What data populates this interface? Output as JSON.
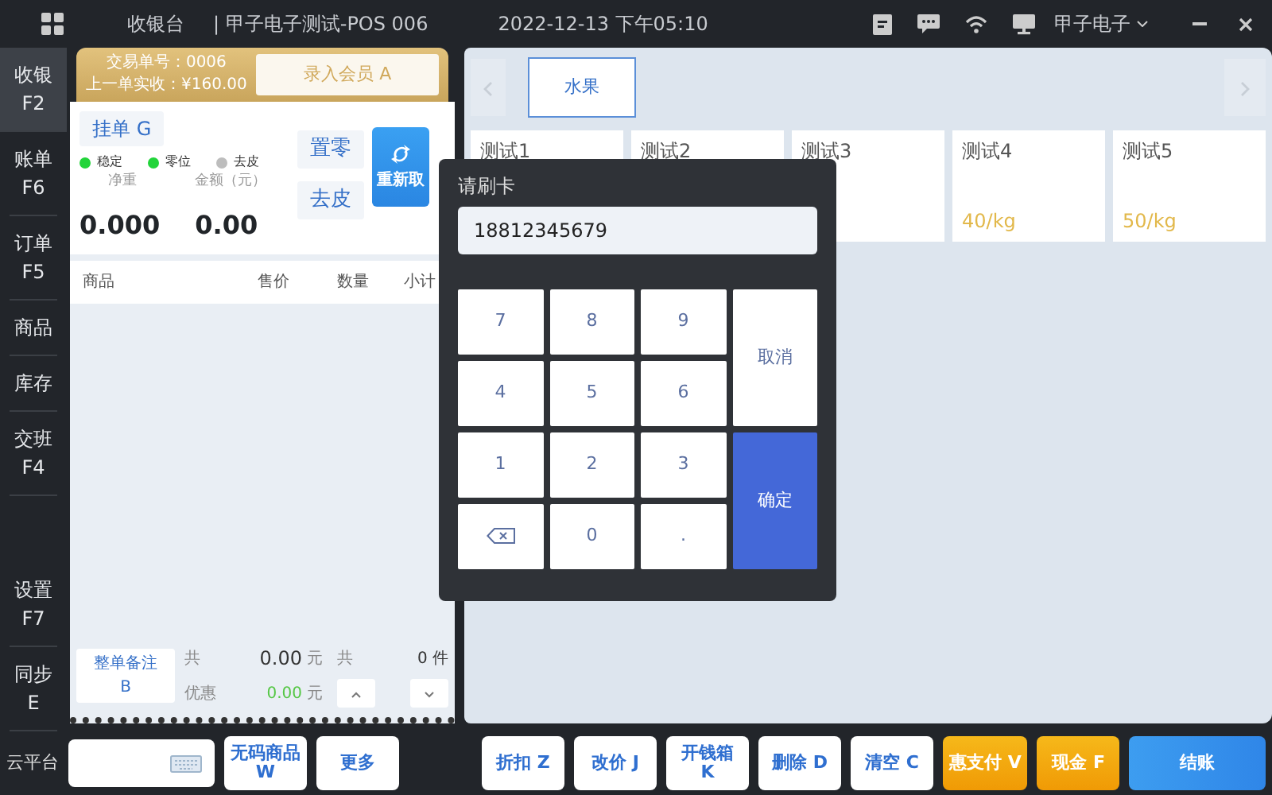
{
  "top_bar": {
    "app_title": "收银台",
    "store": "| 甲子电子测试-POS 006",
    "datetime": "2022-12-13 下午05:10",
    "user": "甲子电子"
  },
  "sidebar": {
    "items": [
      {
        "label": "收银",
        "hotkey": "F2",
        "selected": true
      },
      {
        "label": "账单",
        "hotkey": "F6",
        "selected": false
      },
      {
        "label": "订单",
        "hotkey": "F5",
        "selected": false
      },
      {
        "label": "商品",
        "selected": false
      },
      {
        "label": "库存",
        "selected": false
      },
      {
        "label": "交班",
        "hotkey": "F4",
        "selected": false
      }
    ],
    "bottom_items": [
      {
        "label": "设置",
        "hotkey": "F7",
        "selected": false
      },
      {
        "label": "同步",
        "hotkey": "E",
        "selected": false
      }
    ]
  },
  "order_header": {
    "trade_no": "交易单号：0006",
    "last_paid": "上一单实收：¥160.00",
    "member_button": "录入会员 A"
  },
  "scale": {
    "hold_button": "挂单 G",
    "indicators": [
      {
        "label": "稳定",
        "on": true
      },
      {
        "label": "零位",
        "on": true
      },
      {
        "label": "去皮",
        "on": false
      }
    ],
    "net_weight_label": "净重",
    "net_weight": "0.000",
    "amount_label": "金额（元）",
    "amount": "0.00",
    "zero_button": "置零",
    "tare_button": "去皮",
    "reweigh_button": "重新取"
  },
  "table": {
    "columns": [
      "商品",
      "售价",
      "数量",
      "小计"
    ]
  },
  "summary": {
    "note_button": "整单备注 B",
    "total_label": "共",
    "total": "0.00",
    "total_unit": "元",
    "count_label": "共",
    "count": "0",
    "count_unit": "件",
    "discount_label": "优惠",
    "discount": "0.00",
    "discount_unit": "元"
  },
  "categories": [
    {
      "label": "水果",
      "selected": true
    }
  ],
  "products": [
    {
      "name": "测试1"
    },
    {
      "name": "测试2"
    },
    {
      "name": "测试3"
    },
    {
      "name": "测试4",
      "price": "40/kg"
    },
    {
      "name": "测试5",
      "price": "50/kg"
    }
  ],
  "card_dialog": {
    "title": "请刷卡",
    "value": "18812345679",
    "keys": [
      {
        "kind": "digit",
        "label": "7"
      },
      {
        "kind": "digit",
        "label": "8"
      },
      {
        "kind": "digit",
        "label": "9"
      },
      {
        "kind": "cancel",
        "label": "取消"
      },
      {
        "kind": "digit",
        "label": "4"
      },
      {
        "kind": "digit",
        "label": "5"
      },
      {
        "kind": "digit",
        "label": "6"
      },
      {
        "kind": "digit",
        "label": "1"
      },
      {
        "kind": "digit",
        "label": "2"
      },
      {
        "kind": "digit",
        "label": "3"
      },
      {
        "kind": "confirm",
        "label": "确定"
      },
      {
        "kind": "backspace"
      },
      {
        "kind": "digit",
        "label": "0"
      },
      {
        "kind": "digit",
        "label": "."
      }
    ]
  },
  "bottom_bar": {
    "label": "云平台",
    "left_buttons": [
      {
        "lines": [
          "无码商品",
          "W"
        ],
        "kind": "plain"
      },
      {
        "lines": [
          "更多"
        ],
        "kind": "plain"
      }
    ],
    "right_buttons": [
      {
        "lines": [
          "折扣 Z"
        ],
        "kind": "plain"
      },
      {
        "lines": [
          "改价 J"
        ],
        "kind": "plain"
      },
      {
        "lines": [
          "开钱箱",
          "K"
        ],
        "kind": "plain"
      },
      {
        "lines": [
          "删除 D"
        ],
        "kind": "plain"
      },
      {
        "lines": [
          "清空 C"
        ],
        "kind": "plain"
      },
      {
        "lines": [
          "惠支付 V"
        ],
        "kind": "orange"
      },
      {
        "lines": [
          "现金 F"
        ],
        "kind": "orange"
      },
      {
        "lines": [
          "结账"
        ],
        "kind": "primary"
      }
    ]
  }
}
